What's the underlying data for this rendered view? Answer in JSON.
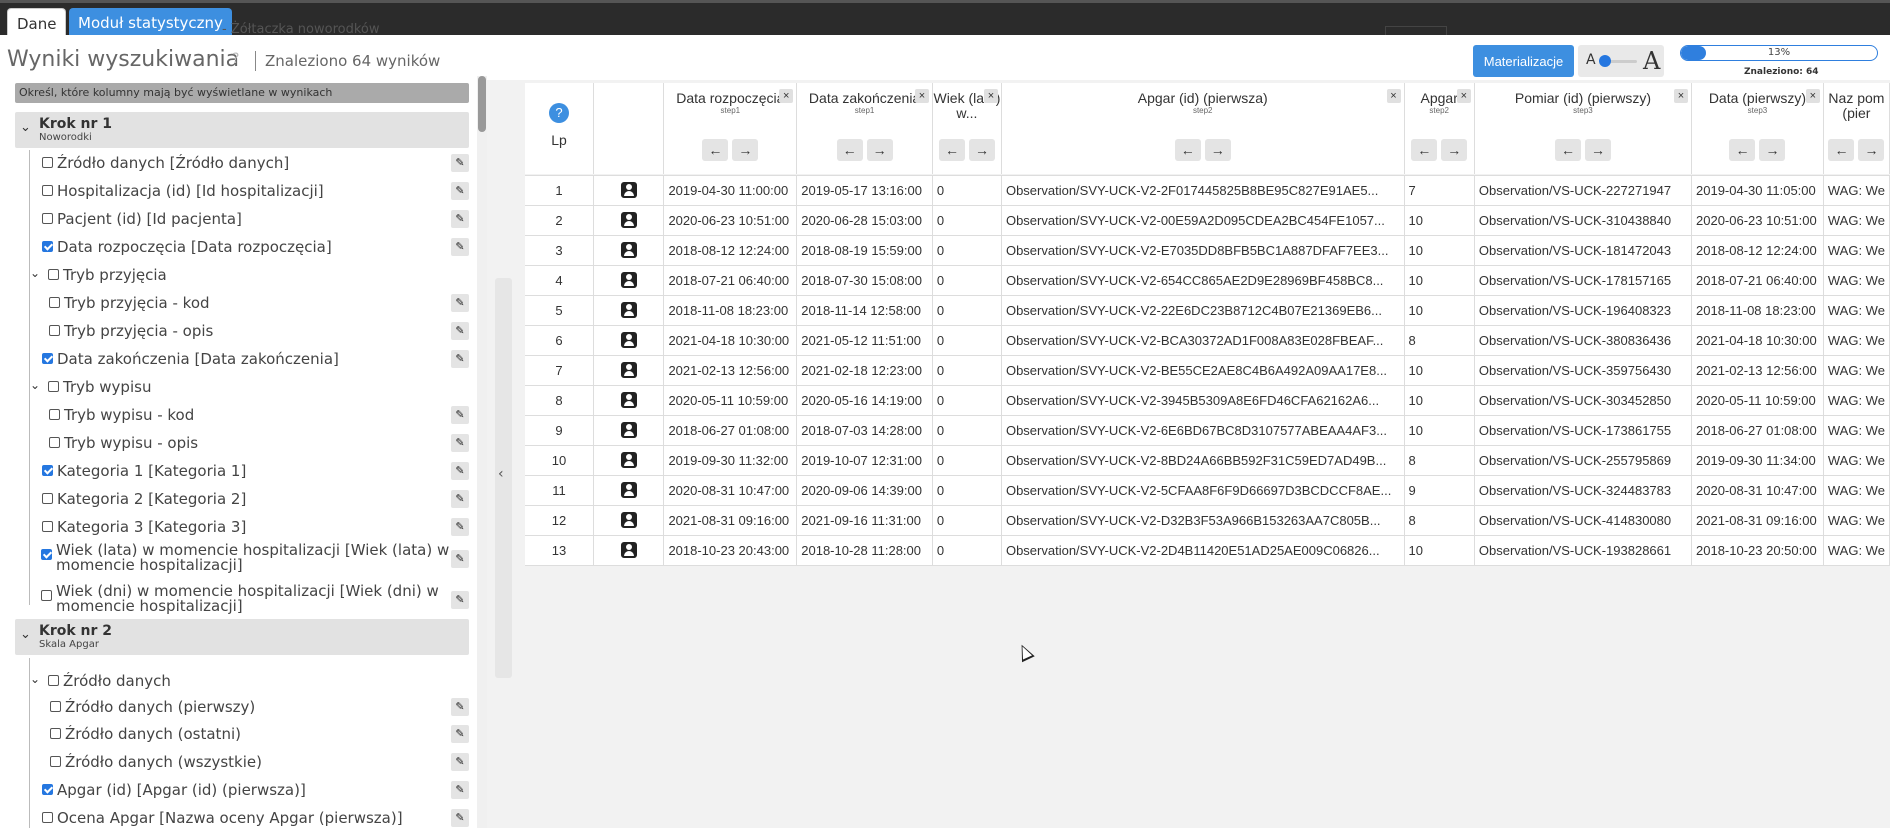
{
  "tabs": {
    "dane": "Dane",
    "modul": "Moduł statystyczny",
    "ghost_title": "- Żółtaczka noworodków"
  },
  "header": {
    "title": "Wyniki wyszukiwania",
    "help": "?",
    "found": "Znaleziono 64 wyników",
    "materialize": "Materializacje",
    "font_small": "A",
    "font_big": "A",
    "progress_value": 0.13,
    "progress_text": "13%",
    "found_small": "Znaleziono: 64"
  },
  "sidebar": {
    "hint": "Określ, które kolumny mają być wyświetlane w wynikach",
    "steps": [
      {
        "title": "Krok nr 1",
        "subtitle": "Noworodki"
      },
      {
        "title": "Krok nr 2",
        "subtitle": "Skala Apgar"
      }
    ],
    "items": [
      {
        "label": "Źródło danych [Źródło danych]",
        "checked": false
      },
      {
        "label": "Hospitalizacja (id) [Id hospitalizacji]",
        "checked": false
      },
      {
        "label": "Pacjent (id) [Id pacjenta]",
        "checked": false
      },
      {
        "label": "Data rozpoczęcia [Data rozpoczęcia]",
        "checked": true
      },
      {
        "label": "Tryb przyjęcia",
        "checked": false,
        "group": true
      },
      {
        "label": "Tryb przyjęcia - kod",
        "checked": false
      },
      {
        "label": "Tryb przyjęcia - opis",
        "checked": false
      },
      {
        "label": "Data zakończenia [Data zakończenia]",
        "checked": true
      },
      {
        "label": "Tryb wypisu",
        "checked": false,
        "group": true
      },
      {
        "label": "Tryb wypisu - kod",
        "checked": false
      },
      {
        "label": "Tryb wypisu - opis",
        "checked": false
      },
      {
        "label": "Kategoria 1 [Kategoria 1]",
        "checked": true
      },
      {
        "label": "Kategoria 2 [Kategoria 2]",
        "checked": false
      },
      {
        "label": "Kategoria 3 [Kategoria 3]",
        "checked": false
      },
      {
        "label": "Wiek (lata) w momencie hospitalizacji [Wiek (lata) w momencie hospitalizacji]",
        "checked": true
      },
      {
        "label": "Wiek (dni) w momencie hospitalizacji [Wiek (dni) w momencie hospitalizacji]",
        "checked": false
      },
      {
        "label": "Źródło danych",
        "checked": false,
        "group": true
      },
      {
        "label": "Źródło danych (pierwszy)",
        "checked": false
      },
      {
        "label": "Źródło danych (ostatni)",
        "checked": false
      },
      {
        "label": "Źródło danych (wszystkie)",
        "checked": false
      },
      {
        "label": "Apgar (id) [Apgar (id) (pierwsza)]",
        "checked": true
      },
      {
        "label": "Ocena Apgar [Nazwa oceny Apgar (pierwsza)]",
        "checked": false
      }
    ]
  },
  "table": {
    "lp_header": "Lp",
    "help": "?",
    "columns": [
      {
        "label": "Data rozpoczęcia",
        "step": "step1"
      },
      {
        "label": "Data zakończenia",
        "step": "step1"
      },
      {
        "label": "Wiek (lata) w...",
        "step": ""
      },
      {
        "label": "Apgar (id) (pierwsza)",
        "step": "step2"
      },
      {
        "label": "Apgar",
        "step": "step2"
      },
      {
        "label": "Pomiar (id) (pierwszy)",
        "step": "step3"
      },
      {
        "label": "Data (pierwszy)",
        "step": "step3"
      },
      {
        "label": "Naz pom (pier",
        "step": ""
      }
    ],
    "rows": [
      {
        "lp": "1",
        "start": "2019-04-30 11:00:00",
        "end": "2019-05-17 13:16:00",
        "age": "0",
        "apgar_id": "Observation/SVY-UCK-V2-2F017445825B8BE95C827E91AE5...",
        "apgar": "7",
        "pomiar": "Observation/VS-UCK-227271947",
        "data": "2019-04-30 11:05:00",
        "name": "WAG: We"
      },
      {
        "lp": "2",
        "start": "2020-06-23 10:51:00",
        "end": "2020-06-28 15:03:00",
        "age": "0",
        "apgar_id": "Observation/SVY-UCK-V2-00E59A2D095CDEA2BC454FE1057...",
        "apgar": "10",
        "pomiar": "Observation/VS-UCK-310438840",
        "data": "2020-06-23 10:51:00",
        "name": "WAG: We"
      },
      {
        "lp": "3",
        "start": "2018-08-12 12:24:00",
        "end": "2018-08-19 15:59:00",
        "age": "0",
        "apgar_id": "Observation/SVY-UCK-V2-E7035DD8BFB5BC1A887DFAF7EE3...",
        "apgar": "10",
        "pomiar": "Observation/VS-UCK-181472043",
        "data": "2018-08-12 12:24:00",
        "name": "WAG: We"
      },
      {
        "lp": "4",
        "start": "2018-07-21 06:40:00",
        "end": "2018-07-30 15:08:00",
        "age": "0",
        "apgar_id": "Observation/SVY-UCK-V2-654CC865AE2D9E28969BF458BC8...",
        "apgar": "10",
        "pomiar": "Observation/VS-UCK-178157165",
        "data": "2018-07-21 06:40:00",
        "name": "WAG: We"
      },
      {
        "lp": "5",
        "start": "2018-11-08 18:23:00",
        "end": "2018-11-14 12:58:00",
        "age": "0",
        "apgar_id": "Observation/SVY-UCK-V2-22E6DC23B8712C4B07E21369EB6...",
        "apgar": "10",
        "pomiar": "Observation/VS-UCK-196408323",
        "data": "2018-11-08 18:23:00",
        "name": "WAG: We"
      },
      {
        "lp": "6",
        "start": "2021-04-18 10:30:00",
        "end": "2021-05-12 11:51:00",
        "age": "0",
        "apgar_id": "Observation/SVY-UCK-V2-BCA30372AD1F008A83E028FBEAF...",
        "apgar": "8",
        "pomiar": "Observation/VS-UCK-380836436",
        "data": "2021-04-18 10:30:00",
        "name": "WAG: We"
      },
      {
        "lp": "7",
        "start": "2021-02-13 12:56:00",
        "end": "2021-02-18 12:23:00",
        "age": "0",
        "apgar_id": "Observation/SVY-UCK-V2-BE55CE2AE8C4B6A492A09AA17E8...",
        "apgar": "10",
        "pomiar": "Observation/VS-UCK-359756430",
        "data": "2021-02-13 12:56:00",
        "name": "WAG: We"
      },
      {
        "lp": "8",
        "start": "2020-05-11 10:59:00",
        "end": "2020-05-16 14:19:00",
        "age": "0",
        "apgar_id": "Observation/SVY-UCK-V2-3945B5309A8E6FD46CFA62162A6...",
        "apgar": "10",
        "pomiar": "Observation/VS-UCK-303452850",
        "data": "2020-05-11 10:59:00",
        "name": "WAG: We"
      },
      {
        "lp": "9",
        "start": "2018-06-27 01:08:00",
        "end": "2018-07-03 14:28:00",
        "age": "0",
        "apgar_id": "Observation/SVY-UCK-V2-6E6BD67BC8D3107577ABEAA4AF3...",
        "apgar": "10",
        "pomiar": "Observation/VS-UCK-173861755",
        "data": "2018-06-27 01:08:00",
        "name": "WAG: We"
      },
      {
        "lp": "10",
        "start": "2019-09-30 11:32:00",
        "end": "2019-10-07 12:31:00",
        "age": "0",
        "apgar_id": "Observation/SVY-UCK-V2-8BD24A66BB592F31C59ED7AD49B...",
        "apgar": "8",
        "pomiar": "Observation/VS-UCK-255795869",
        "data": "2019-09-30 11:34:00",
        "name": "WAG: We"
      },
      {
        "lp": "11",
        "start": "2020-08-31 10:47:00",
        "end": "2020-09-06 14:39:00",
        "age": "0",
        "apgar_id": "Observation/SVY-UCK-V2-5CFAA8F6F9D66697D3BCDCCF8AE...",
        "apgar": "9",
        "pomiar": "Observation/VS-UCK-324483783",
        "data": "2020-08-31 10:47:00",
        "name": "WAG: We"
      },
      {
        "lp": "12",
        "start": "2021-08-31 09:16:00",
        "end": "2021-09-16 11:31:00",
        "age": "0",
        "apgar_id": "Observation/SVY-UCK-V2-D32B3F53A966B153263AA7C805B...",
        "apgar": "8",
        "pomiar": "Observation/VS-UCK-414830080",
        "data": "2021-08-31 09:16:00",
        "name": "WAG: We"
      },
      {
        "lp": "13",
        "start": "2018-10-23 20:43:00",
        "end": "2018-10-28 11:28:00",
        "age": "0",
        "apgar_id": "Observation/SVY-UCK-V2-2D4B11420E51AD25AE009C06826...",
        "apgar": "10",
        "pomiar": "Observation/VS-UCK-193828661",
        "data": "2018-10-23 20:50:00",
        "name": "WAG: We"
      }
    ]
  },
  "icons": {
    "close": "×",
    "arrow_left": "←",
    "arrow_right": "→",
    "edit": "✎",
    "chevron_down": "⌄",
    "collapse": "‹"
  },
  "colors": {
    "accent": "#3d8fe0",
    "checkbox": "#2577e0"
  }
}
